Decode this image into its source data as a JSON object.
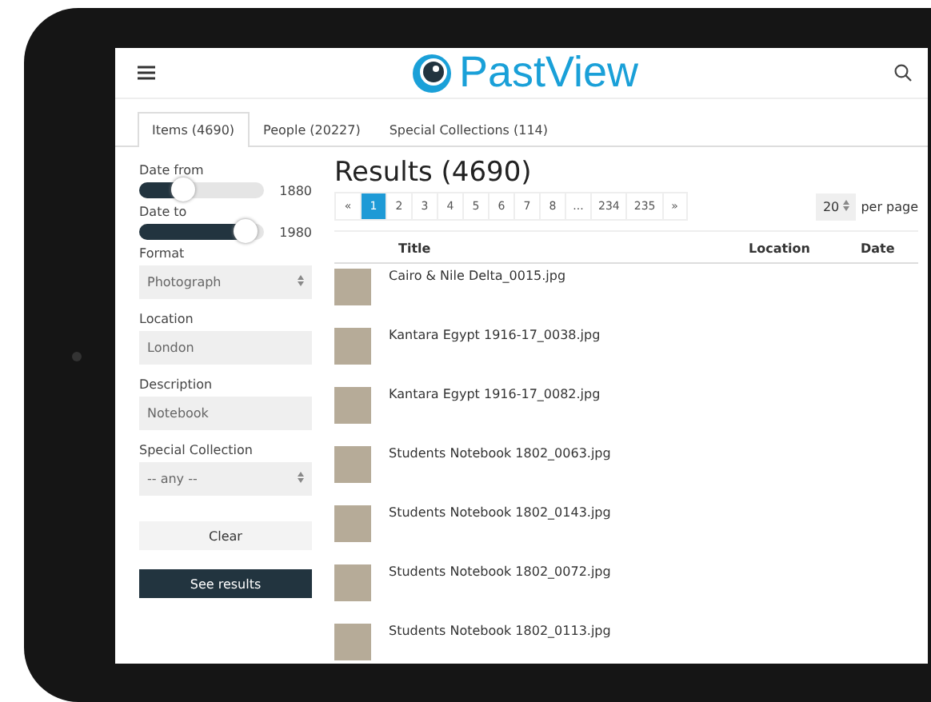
{
  "header": {
    "logo": "PastView"
  },
  "tabs": [
    {
      "label": "Items (4690)",
      "selected": true
    },
    {
      "label": "People (20227)",
      "selected": false
    },
    {
      "label": "Special Collections (114)",
      "selected": false
    }
  ],
  "filters": [
    {
      "kind": "slider",
      "label": "Date from",
      "level": 0.35,
      "reading": "1880"
    },
    {
      "kind": "slider",
      "label": "Date to",
      "level": 0.85,
      "reading": "1980"
    },
    {
      "kind": "select",
      "label": "Format",
      "value": "Photograph"
    },
    {
      "kind": "input",
      "label": "Location",
      "value": "London"
    },
    {
      "kind": "input",
      "label": "Description",
      "value": "Notebook"
    },
    {
      "kind": "select",
      "label": "Special Collection",
      "value": "-- any --"
    }
  ],
  "buttons": [
    {
      "label": "Clear",
      "kind": "secondary"
    },
    {
      "label": "See results",
      "kind": "primary"
    }
  ],
  "results": {
    "heading": "Results (4690)",
    "pages": [
      {
        "label": "«",
        "selected": false
      },
      {
        "label": "1",
        "selected": true
      },
      {
        "label": "2",
        "selected": false
      },
      {
        "label": "3",
        "selected": false
      },
      {
        "label": "4",
        "selected": false
      },
      {
        "label": "5",
        "selected": false
      },
      {
        "label": "6",
        "selected": false
      },
      {
        "label": "7",
        "selected": false
      },
      {
        "label": "8",
        "selected": false
      },
      {
        "label": "...",
        "selected": false
      },
      {
        "label": "234",
        "selected": false
      },
      {
        "label": "235",
        "selected": false
      },
      {
        "label": "»",
        "selected": false
      }
    ],
    "per_page": "20",
    "per_page_label": "per page",
    "columns": [
      "Title",
      "Location",
      "Date"
    ],
    "rows": [
      {
        "title": "Cairo & Nile Delta_0015.jpg"
      },
      {
        "title": "Kantara Egypt 1916-17_0038.jpg"
      },
      {
        "title": "Kantara Egypt 1916-17_0082.jpg"
      },
      {
        "title": "Students Notebook 1802_0063.jpg"
      },
      {
        "title": "Students Notebook 1802_0143.jpg"
      },
      {
        "title": "Students Notebook 1802_0072.jpg"
      },
      {
        "title": "Students Notebook 1802_0113.jpg"
      }
    ]
  }
}
